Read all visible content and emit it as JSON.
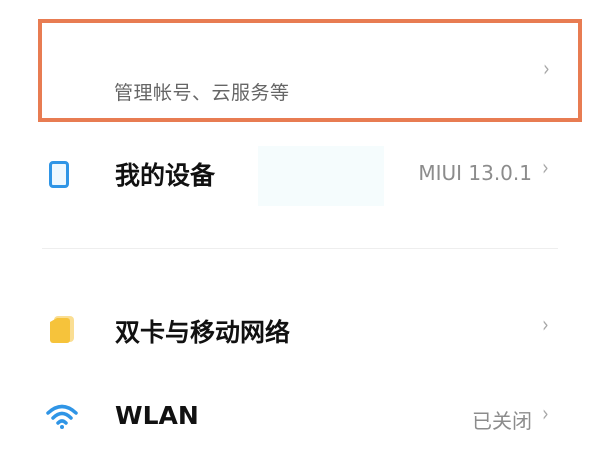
{
  "account": {
    "subtitle": "管理帐号、云服务等",
    "chevron": "›",
    "highlight_color": "#E87C52"
  },
  "settings": [
    {
      "title": "我的设备",
      "value": "MIUI 13.0.1",
      "icon": "device-icon",
      "chevron": "›"
    },
    {
      "title": "双卡与移动网络",
      "value": "",
      "icon": "sim-card-icon",
      "chevron": "›"
    },
    {
      "title": "WLAN",
      "value": "已关闭",
      "icon": "wifi-icon",
      "chevron": "›"
    }
  ],
  "colors": {
    "accent_blue": "#2F95E6",
    "sim_yellow": "#F6C33B",
    "wifi_blue": "#2F95E6"
  }
}
